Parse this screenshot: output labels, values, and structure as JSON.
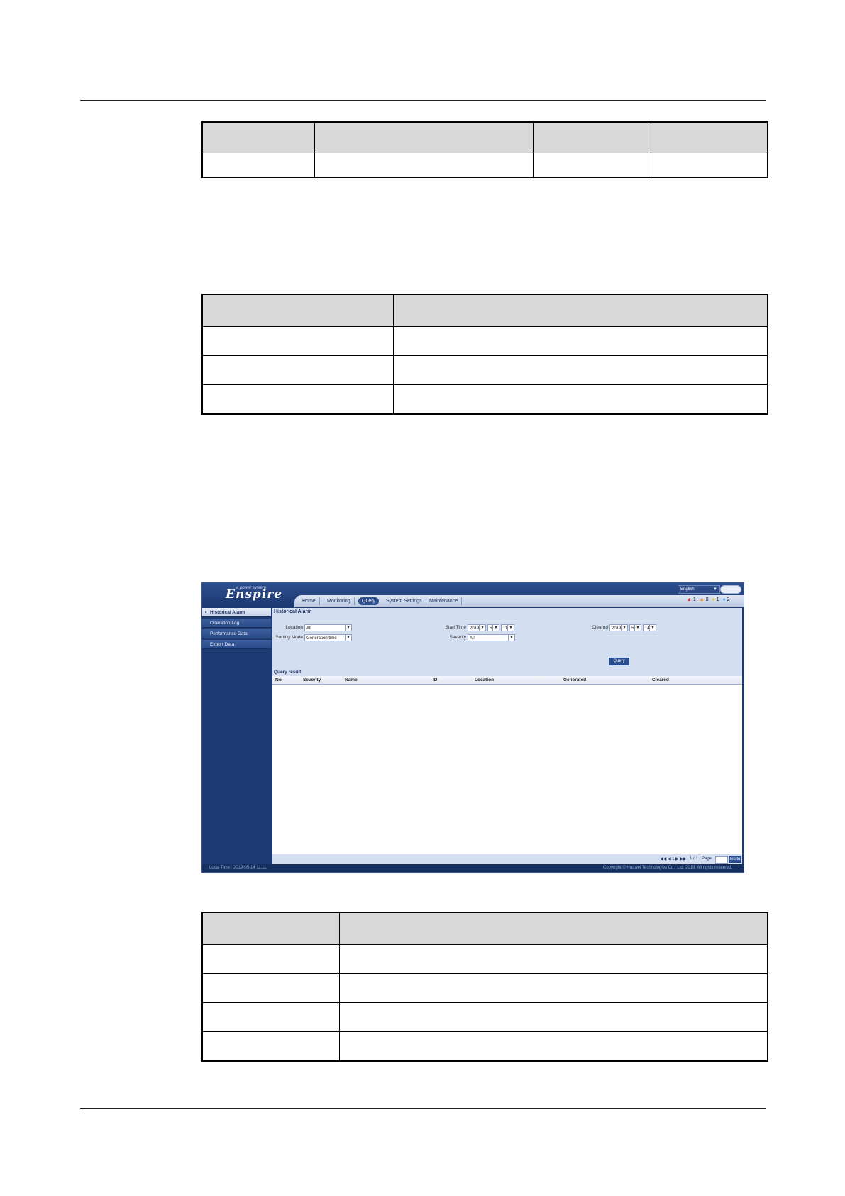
{
  "ui": {
    "logo_tagline": "a power system",
    "logo_text": "Enspire",
    "language": "English",
    "tabs": [
      {
        "label": "Home"
      },
      {
        "label": "Monitoring"
      },
      {
        "label": "Query"
      },
      {
        "label": "System Settings"
      },
      {
        "label": "Maintenance"
      }
    ],
    "alarms": [
      {
        "symbol": "▲",
        "count": "1",
        "color": "#e23b2e"
      },
      {
        "symbol": "▲",
        "count": "0",
        "color": "#f28c1b"
      },
      {
        "symbol": "●",
        "count": "1",
        "color": "#f2c51b"
      },
      {
        "symbol": "●",
        "count": "2",
        "color": "#4aa3ea"
      }
    ],
    "sidebar": [
      {
        "label": "Historical Alarm"
      },
      {
        "label": "Operation Log"
      },
      {
        "label": "Performance Data"
      },
      {
        "label": "Export Data"
      }
    ],
    "page_title": "Historical Alarm",
    "filters": {
      "location_label": "Location",
      "location_value": "All",
      "sorting_label": "Sorting Mode",
      "sorting_value": "Generation time",
      "start_label": "Start Time",
      "start_year": "2019",
      "start_month": "5",
      "start_day": "11",
      "severity_label": "Severity",
      "severity_value": "All",
      "cleared_label": "Cleared",
      "cleared_year": "2019",
      "cleared_month": "5",
      "cleared_day": "14",
      "query_button": "Query"
    },
    "result_label": "Query result",
    "columns": [
      "No.",
      "Severity",
      "Name",
      "ID",
      "Location",
      "Generated",
      "Cleared"
    ],
    "pager": {
      "nav": "◀◀ ◀ 1 ▶ ▶▶",
      "pages": "1 / 1",
      "page_label": "Page",
      "goto": "Go to"
    },
    "local_time": "Local Time : 2019-05-14 11:11",
    "copyright": "Copyright © Huawei Technologies Co., Ltd. 2019. All rights reserved."
  }
}
